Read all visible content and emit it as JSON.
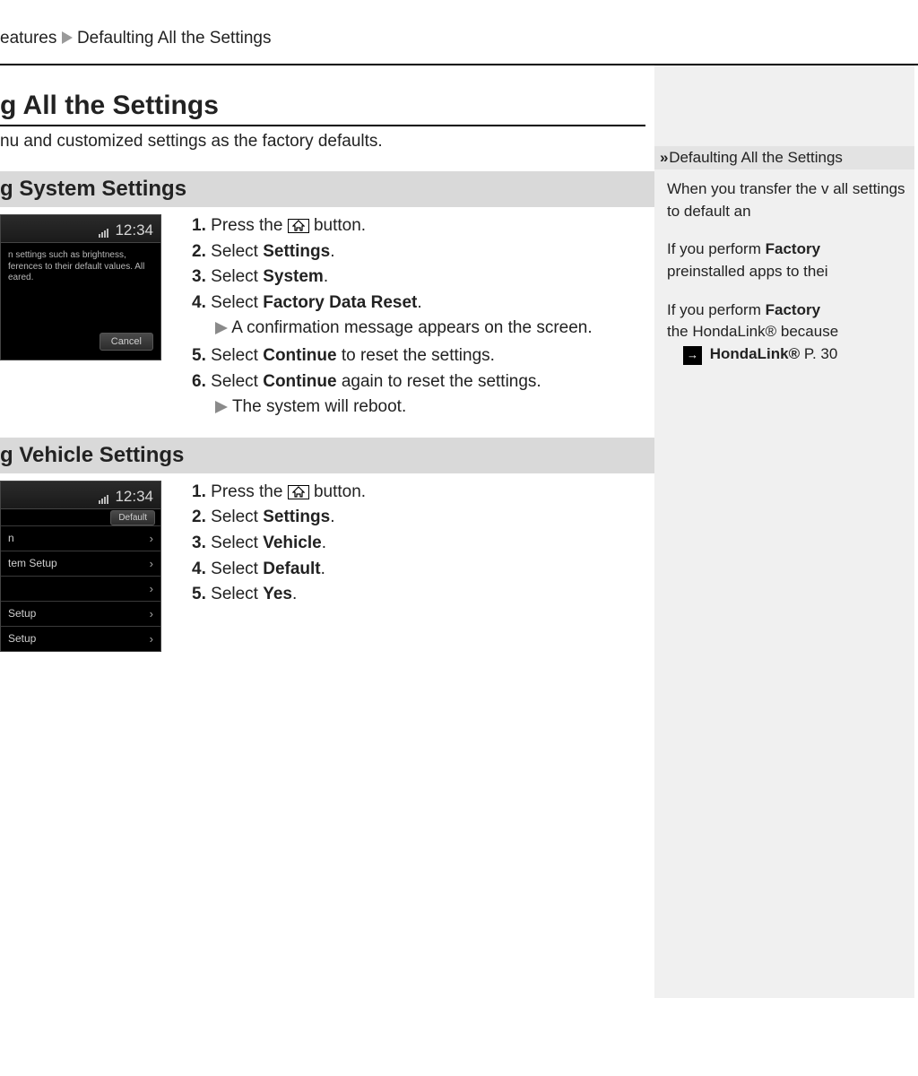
{
  "breadcrumb": {
    "part1": "eatures",
    "part2": "Defaulting All the Settings"
  },
  "title": "g All the Settings",
  "intro": "nu and customized settings as the factory defaults.",
  "section1": {
    "heading": "g System Settings",
    "screenshot": {
      "clock": "12:34",
      "body_text": "n settings such as brightness, ferences to their default values. All eared.",
      "cancel_btn": "Cancel"
    },
    "steps_raw": [
      "Press the [HOME] button.",
      "Select Settings.",
      "Select System.",
      "Select Factory Data Reset.",
      "Select Continue to reset the settings.",
      "Select Continue again to reset the settings."
    ],
    "step1_pre": "Press the ",
    "step1_post": " button.",
    "step2_pre": "Select ",
    "step2_b": "Settings",
    "step2_post": ".",
    "step3_pre": "Select ",
    "step3_b": "System",
    "step3_post": ".",
    "step4_pre": "Select ",
    "step4_b": "Factory Data Reset",
    "step4_post": ".",
    "note4": "A confirmation message appears on the screen.",
    "step5_pre": "Select ",
    "step5_b": "Continue",
    "step5_post": " to reset the settings.",
    "step6_pre": "Select ",
    "step6_b": "Continue",
    "step6_post": " again to reset the settings.",
    "note6": "The system will reboot."
  },
  "section2": {
    "heading": "g Vehicle Settings",
    "screenshot": {
      "clock": "12:34",
      "default_btn": "Default",
      "items": [
        "n",
        "tem Setup",
        "",
        "Setup",
        "Setup"
      ]
    },
    "step1_pre": "Press the ",
    "step1_post": " button.",
    "step2_pre": "Select ",
    "step2_b": "Settings",
    "step2_post": ".",
    "step3_pre": "Select ",
    "step3_b": "Vehicle",
    "step3_post": ".",
    "step4_pre": "Select ",
    "step4_b": "Default",
    "step4_post": ".",
    "step5_pre": "Select ",
    "step5_b": "Yes",
    "step5_post": "."
  },
  "sidebar": {
    "heading": "Defaulting All the Settings",
    "para1": "When you transfer the v all settings to default an",
    "para2a": "If you perform ",
    "para2b": "Factory ",
    "para2c": "preinstalled apps to thei",
    "para3a": "If you perform ",
    "para3b": "Factory ",
    "para3c": "the HondaLink® because",
    "link_label": "HondaLink®",
    "link_page": " P. 30"
  }
}
